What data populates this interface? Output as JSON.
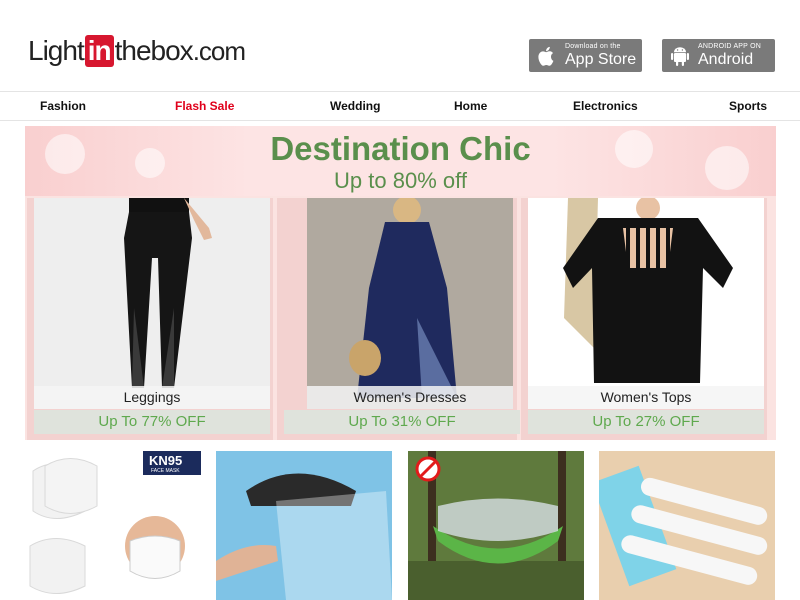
{
  "logo": {
    "part1": "Light",
    "part2": "in",
    "part3": "thebox",
    "part4": ".com"
  },
  "apps": {
    "apple": {
      "small": "Download on the",
      "big": "App Store",
      "icon": "apple-icon"
    },
    "android": {
      "small": "ANDROID APP ON",
      "big": "Android",
      "icon": "android-icon"
    }
  },
  "nav": [
    "Fashion",
    "Flash Sale",
    "Wedding",
    "Home",
    "Electronics",
    "Sports"
  ],
  "banner": {
    "title": "Destination Chic",
    "subtitle": "Up to 80% off",
    "cards": [
      {
        "caption": "Leggings",
        "discount": "Up To 77% OFF"
      },
      {
        "caption": "Women's Dresses",
        "discount": "Up To 31% OFF"
      },
      {
        "caption": "Women's Tops",
        "discount": "Up To 27% OFF"
      }
    ]
  },
  "products": [
    {
      "label": "KN95",
      "sublabel": "FACE MASK"
    },
    {
      "label": ""
    },
    {
      "label": ""
    },
    {
      "label": ""
    }
  ],
  "colors": {
    "accent": "#d7172f",
    "flash": "#e0001b",
    "green": "#5a8f4c",
    "discount": "#5fa94e"
  }
}
